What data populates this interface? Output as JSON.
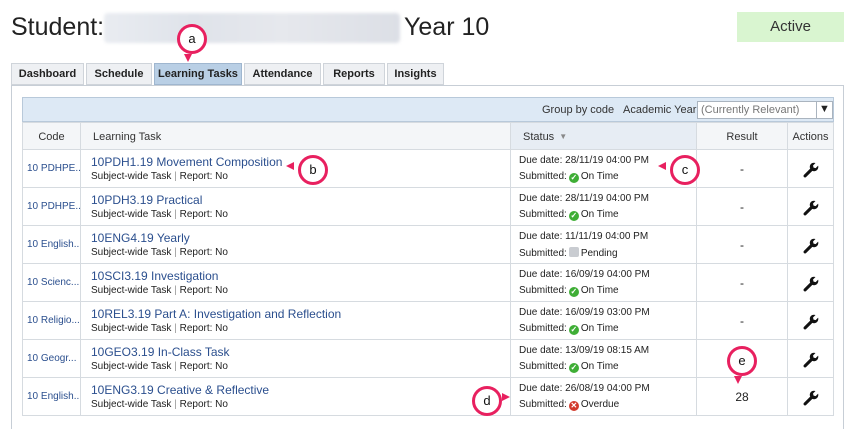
{
  "header": {
    "student_label": "Student:",
    "year_label": "Year 10",
    "status": "Active"
  },
  "tabs": [
    "Dashboard",
    "Schedule",
    "Learning Tasks",
    "Attendance",
    "Reports",
    "Insights"
  ],
  "toolbar": {
    "group_by": "Group by code",
    "academic_year_label": "Academic Year:",
    "academic_year_value": "(Currently Relevant)"
  },
  "columns": {
    "code": "Code",
    "task": "Learning Task",
    "status": "Status",
    "result": "Result",
    "actions": "Actions"
  },
  "meta_labels": {
    "subject_wide": "Subject-wide Task",
    "separator": "|",
    "report_label": "Report:",
    "due_label": "Due date:",
    "submitted_label": "Submitted:"
  },
  "rows": [
    {
      "code": "10 PDHPE...",
      "title": "10PDH1.19 Movement Composition",
      "report": "No",
      "due": "28/11/19 04:00 PM",
      "status": "On Time",
      "result": "-"
    },
    {
      "code": "10 PDHPE...",
      "title": "10PDH3.19 Practical",
      "report": "No",
      "due": "28/11/19 04:00 PM",
      "status": "On Time",
      "result": "-"
    },
    {
      "code": "10 English...",
      "title": "10ENG4.19 Yearly",
      "report": "No",
      "due": "11/11/19 04:00 PM",
      "status": "Pending",
      "result": "-"
    },
    {
      "code": "10 Scienc...",
      "title": "10SCI3.19 Investigation",
      "report": "No",
      "due": "16/09/19 04:00 PM",
      "status": "On Time",
      "result": "-"
    },
    {
      "code": "10 Religio...",
      "title": "10REL3.19 Part A: Investigation and Reflection",
      "report": "No",
      "due": "16/09/19 03:00 PM",
      "status": "On Time",
      "result": "-"
    },
    {
      "code": "10 Geogr...",
      "title": "10GEO3.19 In-Class Task",
      "report": "No",
      "due": "13/09/19 08:15 AM",
      "status": "On Time",
      "result": ""
    },
    {
      "code": "10 English...",
      "title": "10ENG3.19 Creative & Reflective",
      "report": "No",
      "due": "26/08/19 04:00 PM",
      "status": "Overdue",
      "result": "28"
    }
  ],
  "callouts": [
    "a",
    "b",
    "c",
    "d",
    "e"
  ],
  "colors": {
    "active_tab": "#b9cfe5",
    "link": "#2b4f8e",
    "callout": "#e8205f",
    "status_active_bg": "#d9f5d0",
    "on_time": "#3fae36",
    "overdue": "#d23a2c"
  }
}
